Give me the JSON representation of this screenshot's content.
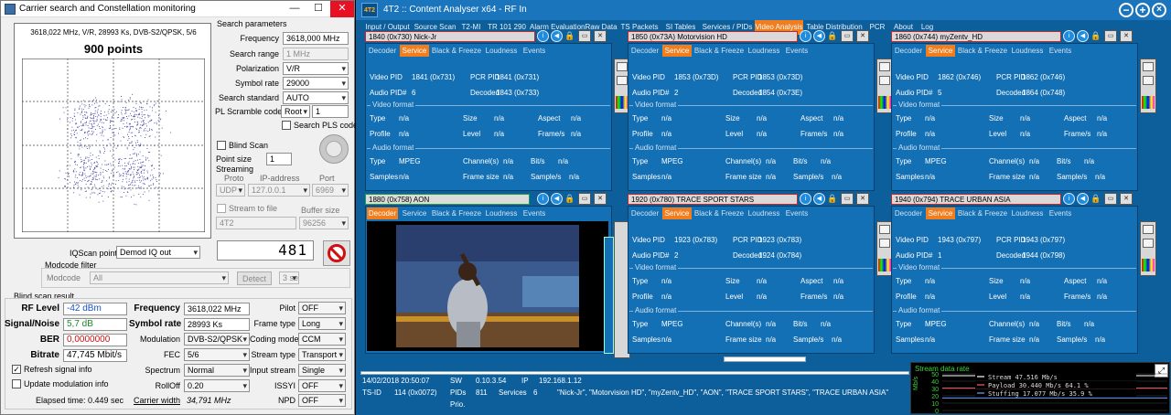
{
  "left_window": {
    "title": "Carrier search and Constellation monitoring",
    "constellation": {
      "info": "3618,022 MHz, V/R, 28993 Ks, DVB-S2/QPSK, 5/6",
      "points_label": "900 points"
    },
    "search_parameters": {
      "group_label": "Search parameters",
      "frequency_label": "Frequency",
      "frequency_value": "3618,000 MHz",
      "search_range_label": "Search range",
      "search_range_value": "1 MHz",
      "polarization_label": "Polarization",
      "polarization_value": "V/R",
      "symbol_rate_label": "Symbol rate",
      "symbol_rate_value": "29000",
      "search_standard_label": "Search standard",
      "search_standard_value": "AUTO",
      "pl_scramble_label": "PL Scramble code",
      "pl_scramble_type": "Root",
      "pl_scramble_value": "1",
      "search_pls_label": "Search PLS code"
    },
    "blind_scan_label": "Blind Scan",
    "point_size_label": "Point size",
    "point_size_value": "1",
    "streaming": {
      "label": "Streaming",
      "proto_label": "Proto",
      "ip_label": "IP-address",
      "port_label": "Port",
      "proto_value": "UDP",
      "ip_value": "127.0.0.1",
      "port_value": "6969",
      "stream_to_file_label": "Stream to file",
      "buffer_size_label": "Buffer size",
      "file_value": "4T2",
      "buffer_value": "96256"
    },
    "counter_value": "481",
    "iqscan_label": "IQScan point",
    "iqscan_value": "Demod IQ out",
    "modcode_filter_label": "Modcode filter",
    "modcode_label": "Modcode",
    "modcode_value": "All",
    "detect_label": "Detect",
    "detect_time": "3 sec",
    "blind_scan_result": {
      "group_label": "Blind scan result",
      "rf_level_label": "RF Level",
      "rf_level_value": "-42 dBm",
      "signal_noise_label": "Signal/Noise",
      "signal_noise_value": "5,7 dB",
      "ber_label": "BER",
      "ber_value": "0,0000000",
      "bitrate_label": "Bitrate",
      "bitrate_value": "47,745 Mbit/s",
      "frequency_label": "Frequency",
      "frequency_value": "3618,022 MHz",
      "symbol_rate_label": "Symbol rate",
      "symbol_rate_value": "28993 Ks",
      "modulation_label": "Modulation",
      "modulation_value": "DVB-S2/QPSK",
      "fec_label": "FEC",
      "fec_value": "5/6",
      "spectrum_label": "Spectrum",
      "spectrum_value": "Normal",
      "rolloff_label": "RollOff",
      "rolloff_value": "0.20",
      "carrier_width_label": "Carrier width",
      "carrier_width_value": "34,791 MHz",
      "pilot_label": "Pilot",
      "pilot_value": "OFF",
      "frame_type_label": "Frame type",
      "frame_type_value": "Long",
      "coding_mode_label": "Coding mode",
      "coding_mode_value": "CCM",
      "stream_type_label": "Stream type",
      "stream_type_value": "Transport",
      "input_stream_label": "Input stream",
      "input_stream_value": "Single",
      "issyi_label": "ISSYI",
      "issyi_value": "OFF",
      "npd_label": "NPD",
      "npd_value": "OFF"
    },
    "refresh_signal_label": "Refresh signal info",
    "update_modulation_label": "Update modulation info",
    "elapsed_label": "Elapsed time: 0.449 sec"
  },
  "right_window": {
    "title": "4T2 :: Content Analyser x64  - RF In",
    "logo": "4T2",
    "menu_tabs": [
      "Input / Output",
      "Source Scan",
      "T2-MI",
      "TR 101 290",
      "Alarm Evaluation",
      "Raw Data",
      "TS Packets",
      "SI Tables",
      "Services / PIDs",
      "Video Analysis",
      "Table Distribution",
      "PCR",
      "About",
      "Log"
    ],
    "active_tab": "Video Analysis",
    "panel_tabs": [
      "Decoder",
      "Service",
      "Black & Freeze",
      "Loudness",
      "Events"
    ],
    "labels": {
      "video_pid": "Video PID",
      "pcr_pid": "PCR PID",
      "audio_pid": "Audio PID#",
      "decoded": "Decoded",
      "video_format": "Video format",
      "audio_format": "Audio format",
      "type": "Type",
      "size": "Size",
      "aspect": "Aspect",
      "profile": "Profile",
      "level": "Level",
      "frames": "Frame/s",
      "channels": "Channel(s)",
      "bits": "Bit/s",
      "samples": "Samples",
      "frame_size": "Frame size",
      "samples_s": "Sample/s",
      "na": "n/a",
      "mpeg": "MPEG"
    },
    "panels": [
      {
        "header": "1840 (0x730) Nick-Jr",
        "active_tab": "Service",
        "video_pid": "1841 (0x731)",
        "pcr_pid": "1841 (0x731)",
        "audio_pid": "6",
        "decoded": "1843 (0x733)"
      },
      {
        "header": "1850 (0x73A) Motorvision HD",
        "active_tab": "Service",
        "video_pid": "1853 (0x73D)",
        "pcr_pid": "1853 (0x73D)",
        "audio_pid": "2",
        "decoded": "1854 (0x73E)"
      },
      {
        "header": "1860 (0x744) myZentv_HD",
        "active_tab": "Service",
        "video_pid": "1862 (0x746)",
        "pcr_pid": "1862 (0x746)",
        "audio_pid": "5",
        "decoded": "1864 (0x748)"
      },
      {
        "header": "1880 (0x758) AON",
        "active_tab": "Decoder"
      },
      {
        "header": "1920 (0x780) TRACE SPORT STARS",
        "active_tab": "Service",
        "video_pid": "1923 (0x783)",
        "pcr_pid": "1923 (0x783)",
        "audio_pid": "2",
        "decoded": "1924 (0x784)"
      },
      {
        "header": "1940 (0x794) TRACE URBAN ASIA",
        "active_tab": "Service",
        "video_pid": "1943 (0x797)",
        "pcr_pid": "1943 (0x797)",
        "audio_pid": "1",
        "decoded": "1944 (0x798)"
      }
    ],
    "status": {
      "datetime": "14/02/2018 20:50:07",
      "sw_label": "SW",
      "sw_value": "0.10.3.54",
      "ip_label": "IP",
      "ip_value": "192.168.1.12",
      "tsid_label": "TS-ID",
      "tsid_value": "114 (0x0072)",
      "pids_label": "PIDs",
      "pids_value": "811",
      "services_label": "Services",
      "services_value": "6",
      "services_list": "\"Nick-Jr\", \"Motorvision HD\", \"myZentv_HD\", \"AON\", \"TRACE SPORT STARS\", \"TRACE URBAN ASIA\"",
      "prio_label": "Prio."
    },
    "stream_rate": {
      "title": "Stream data rate",
      "unit": "Mb/s",
      "yticks": [
        "50",
        "40",
        "30",
        "20",
        "10",
        "0"
      ],
      "legend": [
        {
          "name": "Stream",
          "value": "47.516 Mb/s",
          "pct": "",
          "color": "#ffffff"
        },
        {
          "name": "Payload",
          "value": "30.440 Mb/s",
          "pct": "64.1 %",
          "color": "#ff6060"
        },
        {
          "name": "Stuffing",
          "value": "17.077 Mb/s",
          "pct": "35.9 %",
          "color": "#6aa0ff"
        }
      ]
    }
  }
}
